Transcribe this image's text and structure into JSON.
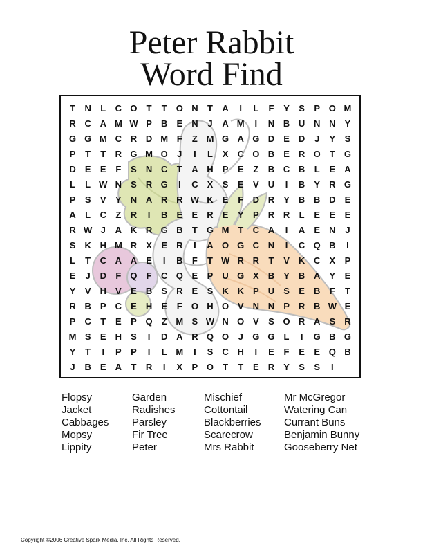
{
  "title": {
    "line1": "Peter Rabbit",
    "line2": "Word Find"
  },
  "grid": [
    "TNLCOTTONTAILFYSPOM",
    "RCAMWPBENJAMINBUNNY",
    "GGMCRDMFZMGAGDEDJYS",
    "PTTRGMOJILXCOBEROTG",
    "DEEFSNCTAHPEZBCBLEA",
    "LLWNSRGICXSEVUIBYR",
    "GPSVYNARRWKEFDRYBBD",
    "EALCZRIBEEREYPRRLEE",
    "ERWJAKRGBTGMTCAIAEN",
    "JSKHMRXERIAOGCNICQB",
    "ILTCAAEIBFTWRRTVKCX",
    "PEJDFQFCQEPUGXBYBAY",
    "EYVHVEBSRESKKPUSEBF",
    "TRBPCEHEFOHOVNNPRBW",
    "EPCTEPQZMSWNOVSORAS",
    "RMSEHSIDARQOJGGLIGB",
    "GYTIPPILMISCHIEFEEQ",
    "BJBEATRIXPOTTERYSSI"
  ],
  "word_columns": [
    [
      "Flopsy",
      "Jacket",
      "Cabbages",
      "Mopsy",
      "Lippity"
    ],
    [
      "Garden",
      "Radishes",
      "Parsley",
      "Fir Tree",
      "Peter"
    ],
    [
      "Mischief",
      "Cottontail",
      "Blackberries",
      "Scarecrow",
      "Mrs Rabbit"
    ],
    [
      "Mr McGregor",
      "Watering Can",
      "Currant Buns",
      "Benjamin Bunny",
      "Gooseberry Net"
    ]
  ],
  "copyright": "Copyright ©2006  Creative Spark Media, Inc.  All Rights Reserved.",
  "colors": {
    "text": "#111111",
    "frame": "#111111",
    "lettuce": "#dfe6b4",
    "carrot": "#f9dcbc",
    "radish": "#e8c8dc",
    "outline": "#bdbdbd"
  },
  "illustration_icon": "rabbit-with-vegetables-watermark"
}
